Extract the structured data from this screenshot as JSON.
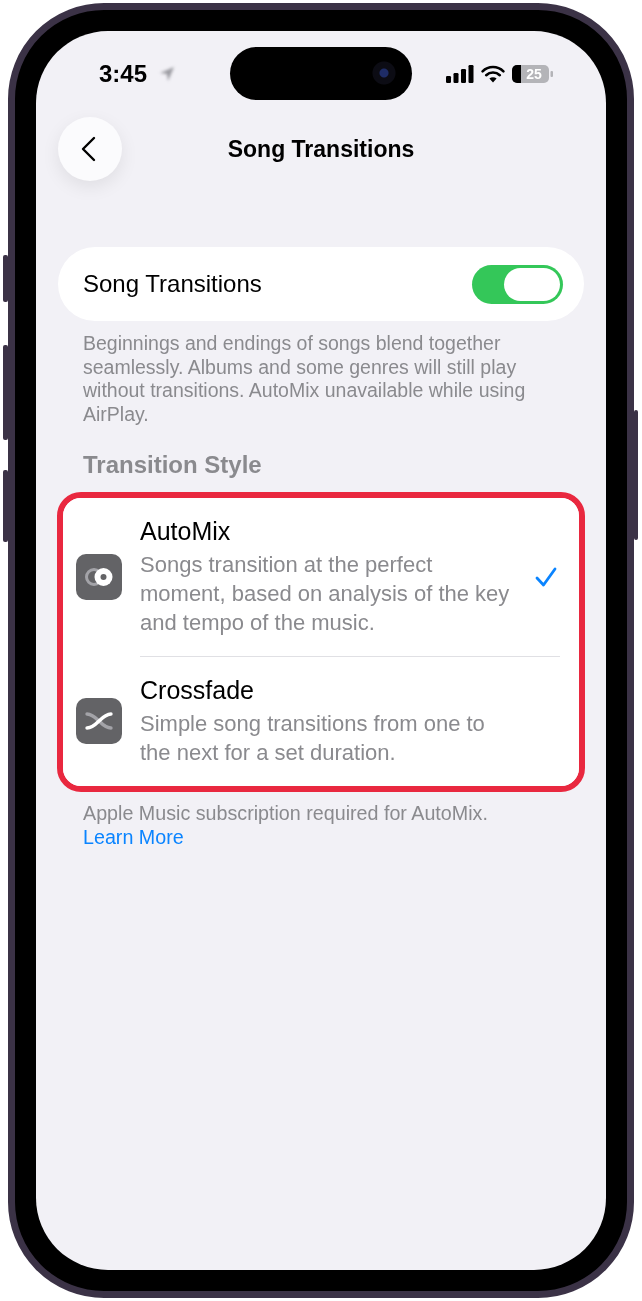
{
  "status_bar": {
    "time": "3:45",
    "battery": "25"
  },
  "nav": {
    "title": "Song Transitions"
  },
  "song_transitions": {
    "label": "Song Transitions",
    "on": true,
    "footer": "Beginnings and endings of songs blend together seamlessly. Albums and some genres will still play without transitions. AutoMix unavailable while using AirPlay."
  },
  "transition_style": {
    "header": "Transition Style",
    "highlighted": true,
    "options": [
      {
        "kind": "automix",
        "title": "AutoMix",
        "description": "Songs transition at the perfect moment, based on analysis of the key and tempo of the music.",
        "selected": true
      },
      {
        "kind": "crossfade",
        "title": "Crossfade",
        "description": "Simple song transitions from one to the next for a set duration.",
        "selected": false
      }
    ],
    "footnote": "Apple Music subscription required for AutoMix.",
    "link": "Learn More"
  }
}
